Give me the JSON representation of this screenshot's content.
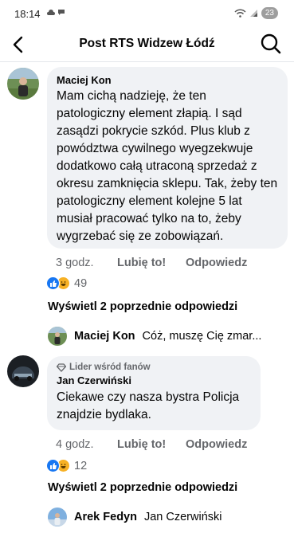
{
  "status_bar": {
    "time": "18:14",
    "battery": "23"
  },
  "header": {
    "title": "Post RTS Widzew Łódź"
  },
  "comments": [
    {
      "author": "Maciej Kon",
      "text": "Mam cichą nadzieję, że ten patologiczny element złapią. I sąd zasądzi pokrycie szkód. Plus klub z powództwa cywilnego wyegzekwuje dodatkowo całą utraconą sprzedaż z okresu zamknięcia sklepu. Tak, żeby ten patologiczny element kolejne 5 lat musiał pracować tylko na to, żeby wygrzebać się ze zobowiązań.",
      "time": "3 godz.",
      "like_label": "Lubię to!",
      "reply_label": "Odpowiedz",
      "reaction_count": "49",
      "view_previous": "Wyświetl 2 poprzednie odpowiedzi",
      "reply_preview": {
        "author": "Maciej Kon",
        "text": "Cóż, muszę Cię zmar..."
      }
    },
    {
      "badge": "Lider wśród fanów",
      "author": "Jan Czerwiński",
      "text": "Ciekawe czy nasza bystra Policja znajdzie bydlaka.",
      "time": "4 godz.",
      "like_label": "Lubię to!",
      "reply_label": "Odpowiedz",
      "reaction_count": "12",
      "view_previous": "Wyświetl 2 poprzednie odpowiedzi",
      "reply_preview": {
        "author": "Arek Fedyn",
        "text": "Jan Czerwiński"
      }
    }
  ],
  "colors": {
    "bubble": "#f0f2f5",
    "like_blue": "#1877f2",
    "haha_yellow": "#f7b125",
    "muted_text": "#65676b"
  }
}
